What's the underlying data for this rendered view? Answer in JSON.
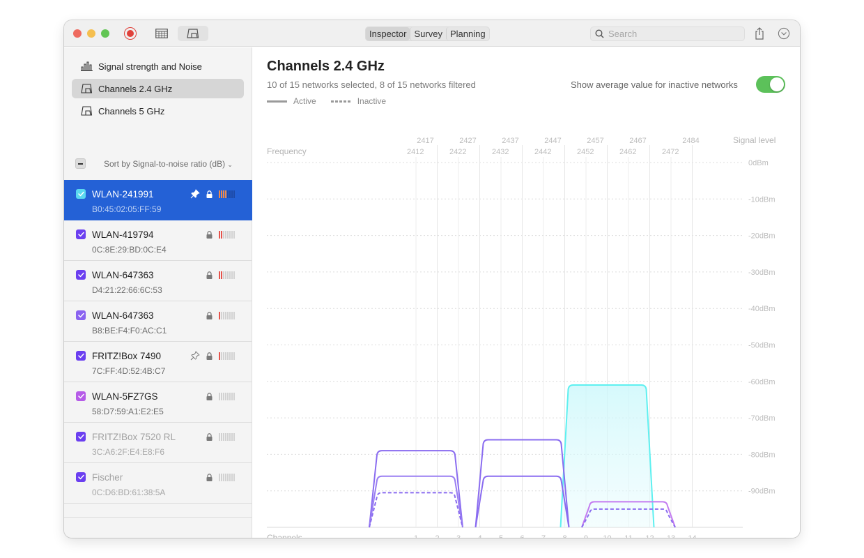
{
  "toolbar": {
    "record_icon": "record-icon",
    "table_icon": "table-view-icon",
    "channels_icon": "channels-view-icon",
    "tabs": [
      {
        "label": "Inspector",
        "active": true
      },
      {
        "label": "Survey",
        "active": false
      },
      {
        "label": "Planning",
        "active": false
      }
    ],
    "search_placeholder": "Search",
    "search_value": "",
    "share_icon": "share-icon",
    "more_icon": "chevron-circle-icon"
  },
  "sidebar": {
    "nav": [
      {
        "label": "Signal strength and Noise",
        "icon": "bar-chart-icon",
        "selected": false
      },
      {
        "label": "Channels 2.4 GHz",
        "icon": "channel-icon",
        "selected": true
      },
      {
        "label": "Channels 5 GHz",
        "icon": "channel-icon",
        "selected": false
      }
    ],
    "sort_label": "Sort by Signal-to-noise ratio (dB)",
    "networks": [
      {
        "name": "WLAN-241991",
        "mac": "B0:45:02:05:FF:59",
        "checkbox_color": "#5ad8f0",
        "pinned": true,
        "pin_style": "filled",
        "locked": true,
        "signal_bars": 4,
        "signal_color": "#f08a4b",
        "selected": true,
        "dim": false
      },
      {
        "name": "WLAN-419794",
        "mac": "0C:8E:29:BD:0C:E4",
        "checkbox_color": "#6b3ff0",
        "pinned": false,
        "locked": true,
        "signal_bars": 2,
        "signal_color": "#e5534b",
        "selected": false,
        "dim": false
      },
      {
        "name": "WLAN-647363",
        "mac": "D4:21:22:66:6C:53",
        "checkbox_color": "#6b3ff0",
        "pinned": false,
        "locked": true,
        "signal_bars": 2,
        "signal_color": "#e5534b",
        "selected": false,
        "dim": false
      },
      {
        "name": "WLAN-647363",
        "mac": "B8:BE:F4:F0:AC:C1",
        "checkbox_color": "#8a63f0",
        "pinned": false,
        "locked": true,
        "signal_bars": 1,
        "signal_color": "#e5534b",
        "selected": false,
        "dim": false
      },
      {
        "name": "FRITZ!Box 7490",
        "mac": "7C:FF:4D:52:4B:C7",
        "checkbox_color": "#6b3ff0",
        "pinned": true,
        "pin_style": "outline",
        "locked": true,
        "signal_bars": 1,
        "signal_color": "#e5534b",
        "selected": false,
        "dim": false
      },
      {
        "name": "WLAN-5FZ7GS",
        "mac": "58:D7:59:A1:E2:E5",
        "checkbox_color": "#b65ce8",
        "pinned": false,
        "locked": true,
        "signal_bars": 0,
        "signal_color": "#e5534b",
        "selected": false,
        "dim": false
      },
      {
        "name": "FRITZ!Box 7520 RL",
        "mac": "3C:A6:2F:E4:E8:F6",
        "checkbox_color": "#6b3ff0",
        "pinned": false,
        "locked": true,
        "signal_bars": 0,
        "signal_color": "#e5534b",
        "selected": false,
        "dim": true
      },
      {
        "name": "Fischer",
        "mac": "0C:D6:BD:61:38:5A",
        "checkbox_color": "#6b3ff0",
        "pinned": false,
        "locked": true,
        "signal_bars": 0,
        "signal_color": "#e5534b",
        "selected": false,
        "dim": true
      }
    ]
  },
  "main": {
    "title": "Channels 2.4 GHz",
    "subtitle": "10 of 15 networks selected, 8 of 15 networks filtered",
    "legend": {
      "active": "Active",
      "inactive": "Inactive"
    },
    "toggle_label": "Show average value for inactive networks",
    "toggle_on": true
  },
  "chart_data": {
    "type": "area",
    "title": "Channels 2.4 GHz",
    "xlabel": "Channels",
    "x_top_label": "Frequency",
    "ylabel": "Signal level",
    "channels": [
      1,
      2,
      3,
      4,
      5,
      6,
      7,
      8,
      9,
      10,
      11,
      12,
      13,
      14
    ],
    "frequencies_row1": [
      2417,
      2427,
      2437,
      2447,
      2457,
      2467,
      2484
    ],
    "frequencies_row2": [
      2412,
      2422,
      2432,
      2442,
      2452,
      2462,
      2472
    ],
    "frequency_channel_map": {
      "2412": 1,
      "2417": 2,
      "2422": 3,
      "2427": 4,
      "2432": 5,
      "2437": 6,
      "2442": 7,
      "2447": 8,
      "2452": 9,
      "2457": 10,
      "2462": 11,
      "2467": 12,
      "2472": 13,
      "2484": 14
    },
    "y_ticks": [
      "0dBm",
      "-10dBm",
      "-20dBm",
      "-30dBm",
      "-40dBm",
      "-50dBm",
      "-60dBm",
      "-70dBm",
      "-80dBm",
      "-90dBm"
    ],
    "y_tick_values": [
      0,
      -10,
      -20,
      -30,
      -40,
      -50,
      -60,
      -70,
      -80,
      -90
    ],
    "ylim": [
      -100,
      0
    ],
    "grid": true,
    "series": [
      {
        "name": "WLAN-241991",
        "channel": 10,
        "signal_dbm": -61,
        "color": "#5ef0f0",
        "style": "solid",
        "filled": true
      },
      {
        "name": "WLAN-419794",
        "channel": 6,
        "signal_dbm": -76,
        "color": "#8a6cf0",
        "style": "solid",
        "filled": false
      },
      {
        "name": "WLAN-647363",
        "channel": 1,
        "signal_dbm": -79,
        "color": "#8a6cf0",
        "style": "solid",
        "filled": false
      },
      {
        "name": "WLAN-647363",
        "channel": 1,
        "signal_dbm": -86,
        "color": "#9a7ef2",
        "style": "solid",
        "filled": false
      },
      {
        "name": "FRITZ!Box 7490",
        "channel": 6,
        "signal_dbm": -86,
        "color": "#8a6cf0",
        "style": "solid",
        "filled": false
      },
      {
        "name": "WLAN-5FZ7GS",
        "channel": 11,
        "signal_dbm": -93,
        "color": "#c47cf0",
        "style": "solid",
        "filled": false
      },
      {
        "name": "FRITZ!Box 7520 RL",
        "channel": 1,
        "signal_dbm": -90.5,
        "color": "#8a6cf0",
        "style": "dashed",
        "filled": false
      },
      {
        "name": "Fischer",
        "channel": 11,
        "signal_dbm": -95,
        "color": "#8a6cf0",
        "style": "dashed",
        "filled": false
      }
    ]
  }
}
